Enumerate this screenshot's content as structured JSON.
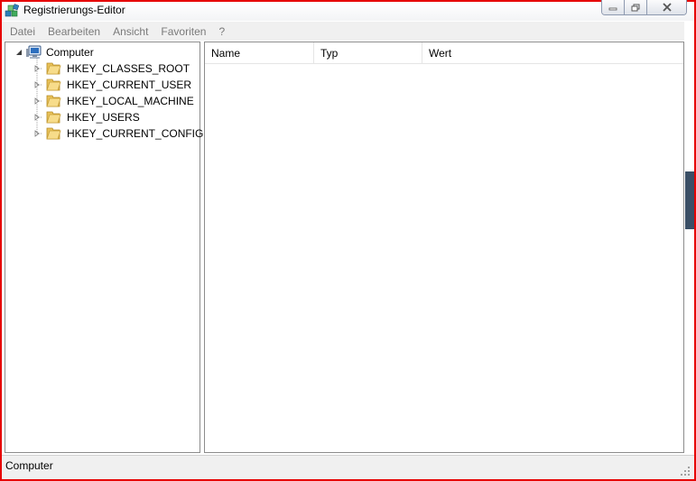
{
  "window": {
    "title": "Registrierungs-Editor",
    "icon": "regedit-icon",
    "border_color": "#e60000"
  },
  "menu": {
    "items": [
      "Datei",
      "Bearbeiten",
      "Ansicht",
      "Favoriten",
      "?"
    ]
  },
  "tree": {
    "root": "Computer",
    "items": [
      "HKEY_CLASSES_ROOT",
      "HKEY_CURRENT_USER",
      "HKEY_LOCAL_MACHINE",
      "HKEY_USERS",
      "HKEY_CURRENT_CONFIG"
    ]
  },
  "list": {
    "columns": [
      "Name",
      "Typ",
      "Wert"
    ]
  },
  "status": {
    "text": "Computer"
  }
}
